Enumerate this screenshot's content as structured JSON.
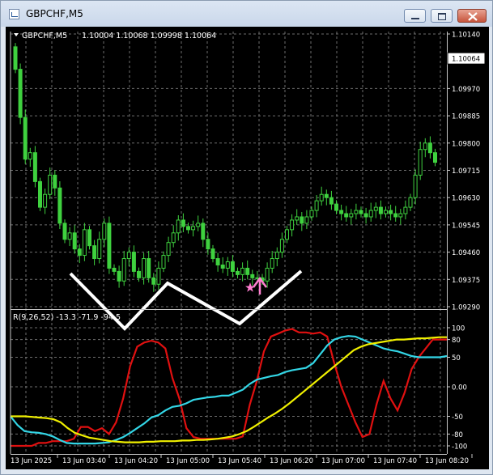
{
  "window": {
    "title": "GBPCHF,M5",
    "minimize_label": "minimize",
    "maximize_label": "maximize",
    "close_label": "close"
  },
  "chart_header": {
    "symbol": "GBPCHF,M5",
    "ohlc": "1.10004 1.10068 1.09998 1.10064"
  },
  "price_axis": {
    "ticks": [
      "1.10140",
      "1.10064",
      "1.09970",
      "1.09885",
      "1.09800",
      "1.09715",
      "1.09630",
      "1.09545",
      "1.09460",
      "1.09375",
      "1.09290"
    ],
    "current_price_label": "1.10064"
  },
  "indicator": {
    "label": "R(9,26,52) -13.3 -71.9 -94.5",
    "ticks": [
      "100",
      "80",
      "50",
      "0.00",
      "-50",
      "-80",
      "-100"
    ],
    "line_colors": {
      "fast": "#e01010",
      "medium": "#33d6e6",
      "slow": "#f0f000"
    }
  },
  "time_axis": {
    "labels": [
      "13 Jun 2025",
      "13 Jun 03:40",
      "13 Jun 04:20",
      "13 Jun 05:00",
      "13 Jun 05:40",
      "13 Jun 06:20",
      "13 Jun 07:00",
      "13 Jun 07:40",
      "13 Jun 08:20"
    ]
  },
  "colors": {
    "background": "#000000",
    "grid": "#6e6e6e",
    "candle": "#3fd13f",
    "text": "#ffffff",
    "pattern": "#ffffff",
    "signal": "#ff7fd0"
  },
  "icons": {
    "title_icon": "chart-window-icon",
    "signal_arrow": "up-arrow-icon",
    "signal_star": "star-icon"
  },
  "chart_data": [
    {
      "type": "candlestick",
      "title": "GBPCHF,M5",
      "y_range": [
        1.0929,
        1.1014
      ],
      "candles_close": [
        1.1003,
        1.0988,
        1.0975,
        1.0977,
        1.0968,
        1.096,
        1.0964,
        1.097,
        1.0966,
        1.0955,
        1.095,
        1.0952,
        1.0947,
        1.0945,
        1.0953,
        1.0948,
        1.0944,
        1.095,
        1.0955,
        1.0941,
        1.094,
        1.0937,
        1.0944,
        1.0946,
        1.094,
        1.0938,
        1.0944,
        1.0938,
        1.0936,
        1.0941,
        1.0945,
        1.0949,
        1.0952,
        1.0956,
        1.0954,
        1.0953,
        1.0954,
        1.0955,
        1.095,
        1.0947,
        1.0944,
        1.0942,
        1.0941,
        1.0943,
        1.094,
        1.0939,
        1.0941,
        1.0939,
        1.0938,
        1.0938,
        1.0937,
        1.0941,
        1.0944,
        1.0946,
        1.095,
        1.0953,
        1.0956,
        1.0957,
        1.0955,
        1.0957,
        1.0959,
        1.0962,
        1.0964,
        1.0963,
        1.0961,
        1.0959,
        1.0958,
        1.0957,
        1.0958,
        1.0959,
        1.0958,
        1.0957,
        1.0959,
        1.096,
        1.0958,
        1.0959,
        1.0958,
        1.0957,
        1.0958,
        1.096,
        1.0963,
        1.097,
        1.0978,
        1.098,
        1.0977,
        1.0974
      ],
      "pattern": "W (double bottom) drawn in white",
      "signal": "buy arrow with star near 13 Jun 05:40"
    },
    {
      "type": "line",
      "title": "R(9,26,52) -13.3 -71.9 -94.5",
      "y_range": [
        -100,
        100
      ],
      "series": [
        {
          "name": "R9",
          "color": "#e01010",
          "values": [
            -100,
            -100,
            -100,
            -100,
            -95,
            -95,
            -92,
            -92,
            -92,
            -88,
            -68,
            -68,
            -75,
            -70,
            -80,
            -60,
            -20,
            35,
            68,
            75,
            78,
            75,
            65,
            15,
            -20,
            -70,
            -85,
            -88,
            -88,
            -88,
            -88,
            -88,
            -88,
            -84,
            -30,
            10,
            60,
            85,
            90,
            95,
            98,
            92,
            92,
            90,
            92,
            85,
            40,
            0,
            -30,
            -60,
            -85,
            -80,
            -30,
            10,
            -20,
            -40,
            -10,
            30,
            50,
            65,
            80,
            80,
            80
          ]
        },
        {
          "name": "R26",
          "color": "#33d6e6",
          "values": [
            -50,
            -65,
            -75,
            -77,
            -78,
            -80,
            -84,
            -90,
            -95,
            -96,
            -96,
            -96,
            -96,
            -95,
            -94,
            -90,
            -85,
            -78,
            -70,
            -62,
            -52,
            -48,
            -40,
            -34,
            -32,
            -28,
            -22,
            -20,
            -18,
            -17,
            -15,
            -15,
            -10,
            -5,
            5,
            12,
            15,
            18,
            20,
            25,
            28,
            30,
            32,
            40,
            55,
            70,
            80,
            84,
            86,
            85,
            80,
            75,
            70,
            65,
            62,
            60,
            56,
            52,
            50,
            50,
            50,
            50,
            52
          ]
        },
        {
          "name": "R52",
          "color": "#f0f000",
          "values": [
            -50,
            -50,
            -50,
            -51,
            -52,
            -53,
            -55,
            -60,
            -70,
            -78,
            -82,
            -86,
            -88,
            -90,
            -92,
            -93,
            -94,
            -94,
            -94,
            -93,
            -93,
            -92,
            -92,
            -92,
            -91,
            -91,
            -90,
            -90,
            -89,
            -88,
            -86,
            -84,
            -80,
            -75,
            -68,
            -60,
            -52,
            -45,
            -37,
            -28,
            -18,
            -8,
            2,
            12,
            22,
            32,
            42,
            52,
            62,
            68,
            72,
            74,
            76,
            78,
            80,
            80,
            81,
            82,
            82,
            83,
            84,
            84
          ]
        }
      ]
    }
  ]
}
